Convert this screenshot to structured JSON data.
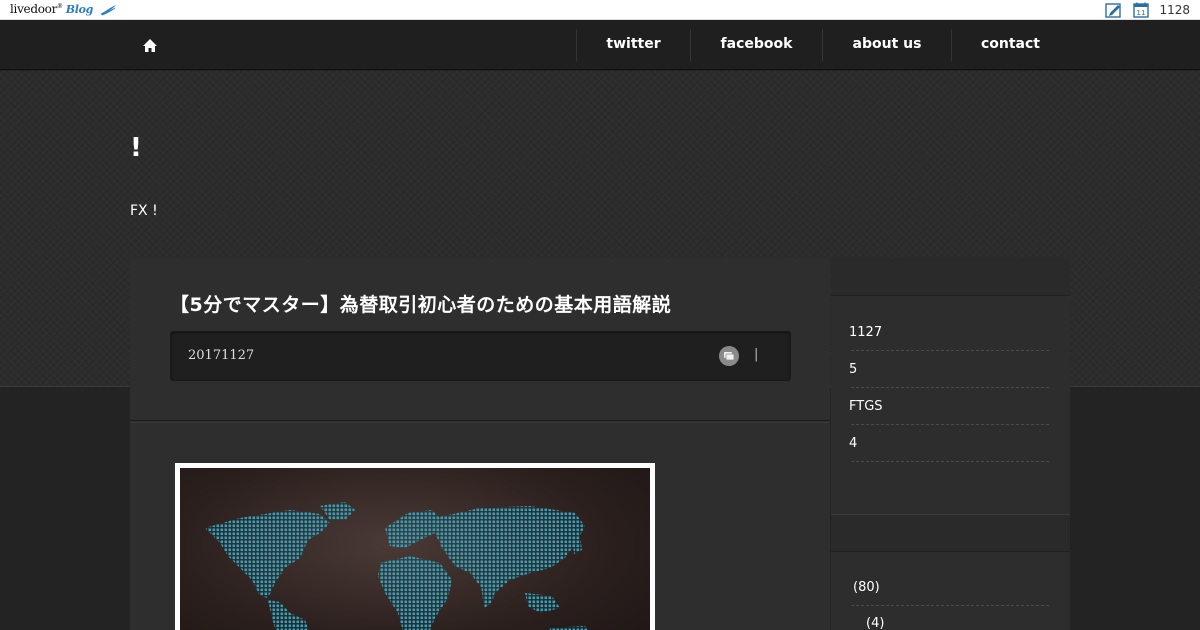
{
  "topbar": {
    "logo": "livedoor",
    "logo_sup": "®",
    "logo_blog": "Blog",
    "calendar_day": "11",
    "count": "1128"
  },
  "nav": {
    "items": [
      {
        "label": "twitter"
      },
      {
        "label": "facebook"
      },
      {
        "label": "about us"
      },
      {
        "label": "contact"
      }
    ]
  },
  "header": {
    "title": "!",
    "description": "FX !"
  },
  "article": {
    "title": "【5分でマスター】為替取引初心者のための基本用語解説",
    "date": "20171127",
    "meta_separator": "|"
  },
  "sidebar": {
    "links": [
      "1127",
      "5",
      "FTGS",
      "4"
    ],
    "categories": [
      "(80)",
      "(4)"
    ]
  },
  "colors": {
    "nav_bg": "#1f1f1f",
    "header_bg": "#2c2c2c",
    "panel_bg": "#2e2e2e",
    "map_dots": "#2aa6c4"
  }
}
